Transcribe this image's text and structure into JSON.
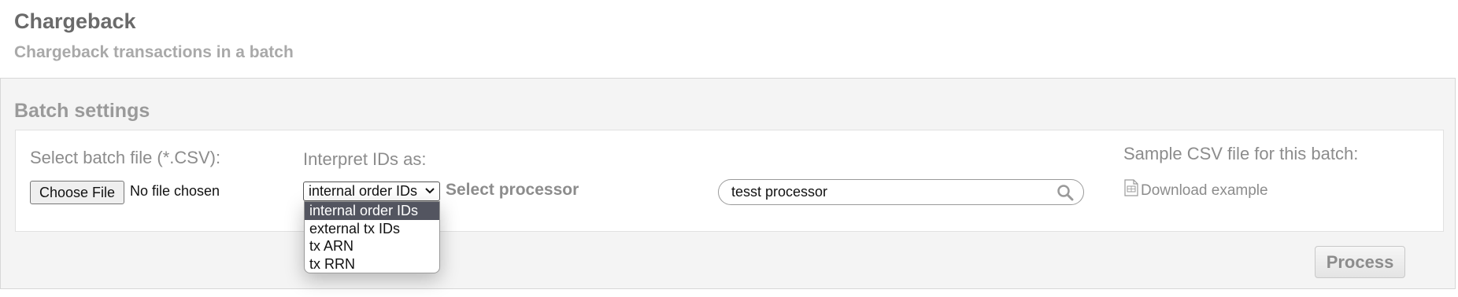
{
  "page": {
    "title": "Chargeback",
    "subtitle": "Chargeback transactions in a batch"
  },
  "panel": {
    "title": "Batch settings"
  },
  "batch_file": {
    "label": "Select batch file (*.CSV):",
    "button_label": "Choose File",
    "status": "No file chosen"
  },
  "interpret": {
    "label": "Interpret IDs as:",
    "selected": "internal order IDs",
    "options": [
      "internal order IDs",
      "external tx IDs",
      "tx ARN",
      "tx RRN"
    ]
  },
  "processor": {
    "label": "Select processor",
    "search_value": "tesst processor",
    "icon": "search-icon"
  },
  "sample": {
    "label": "Sample CSV file for this batch:",
    "link_label": "Download example",
    "icon": "csv-file-icon"
  },
  "actions": {
    "process_label": "Process"
  },
  "colors": {
    "selected_option_bg": "#535560",
    "panel_bg": "#f4f4f4"
  }
}
